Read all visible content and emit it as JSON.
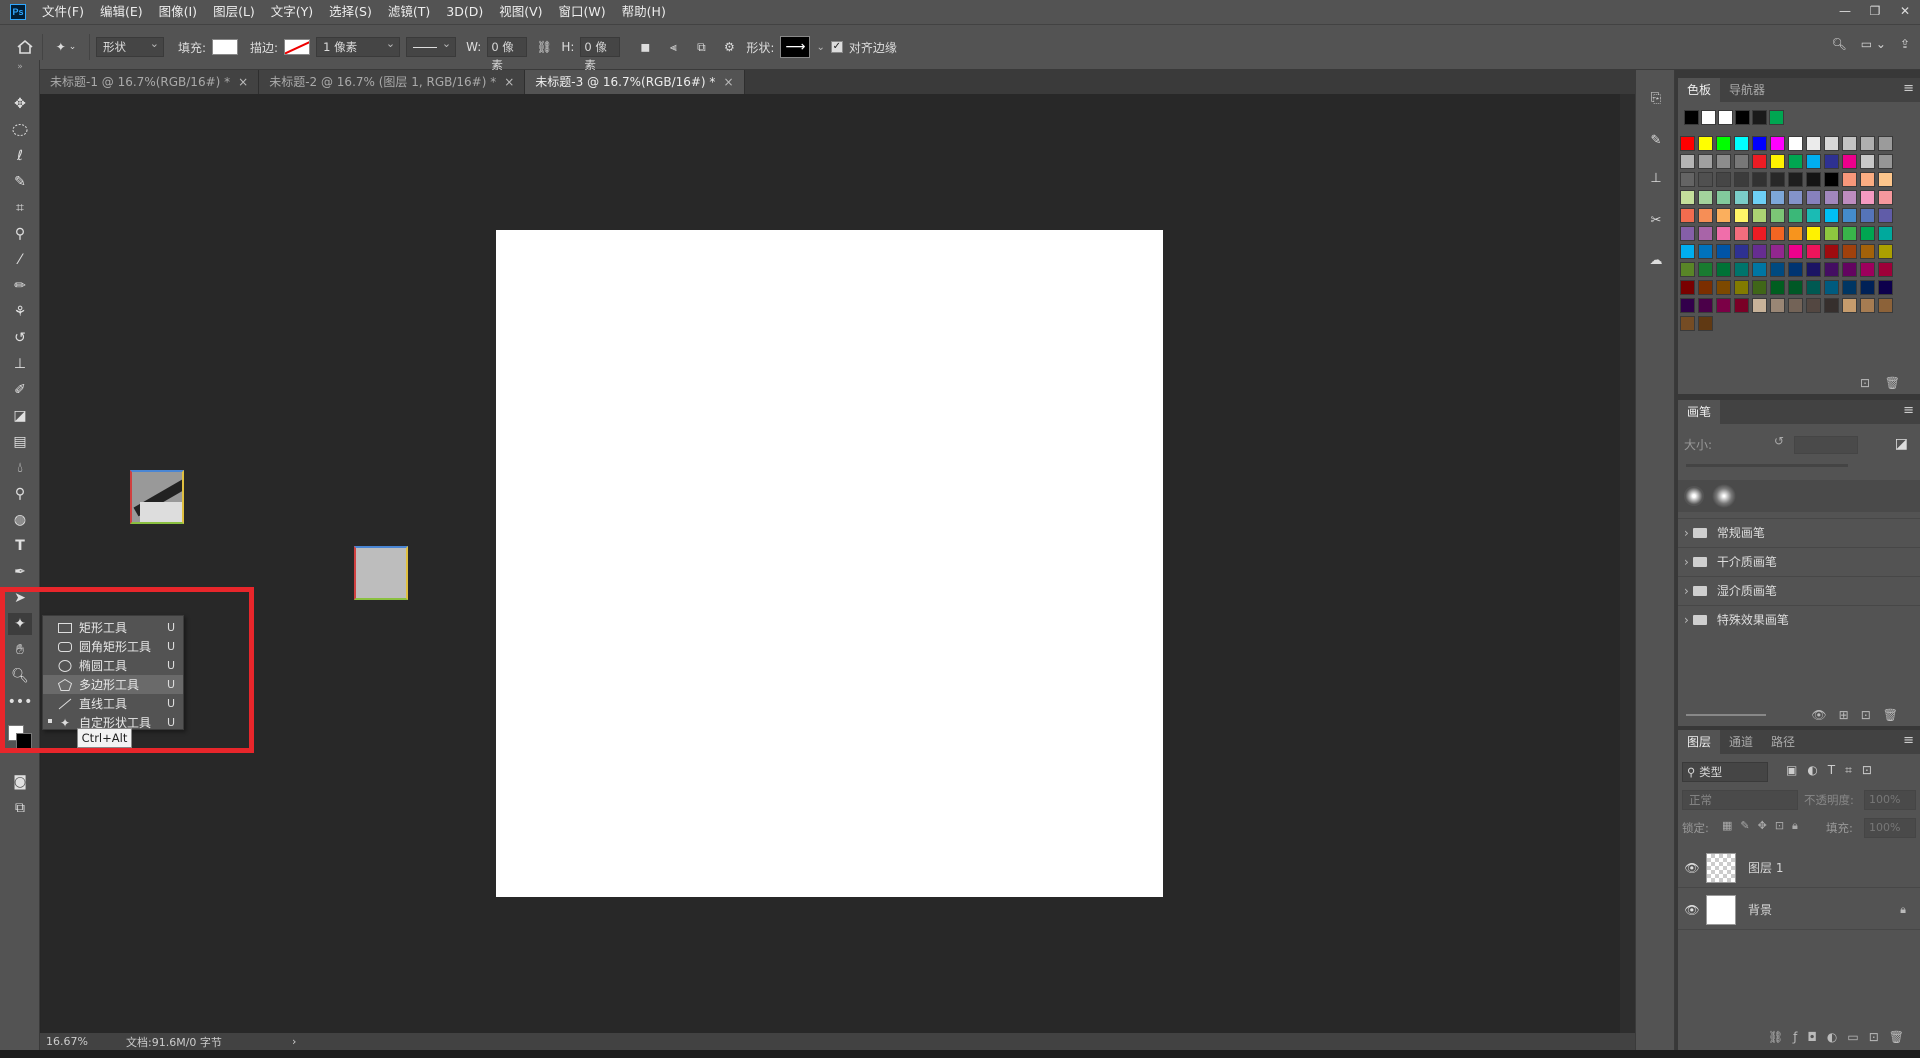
{
  "app": {
    "logo": "Ps"
  },
  "menu": [
    "文件(F)",
    "编辑(E)",
    "图像(I)",
    "图层(L)",
    "文字(Y)",
    "选择(S)",
    "滤镜(T)",
    "3D(D)",
    "视图(V)",
    "窗口(W)",
    "帮助(H)"
  ],
  "options": {
    "mode": "形状",
    "fill_label": "填充:",
    "stroke_label": "描边:",
    "stroke_width": "1 像素",
    "w_label": "W:",
    "w_value": "0 像素",
    "h_label": "H:",
    "h_value": "0 像素",
    "shape_label": "形状:",
    "align_edges": "对齐边缘"
  },
  "tabs": [
    {
      "label": "未标题-1 @ 16.7%(RGB/16#) *",
      "close": "×"
    },
    {
      "label": "未标题-2 @ 16.7% (图层 1, RGB/16#) *",
      "close": "×"
    },
    {
      "label": "未标题-3 @ 16.7%(RGB/16#) *",
      "close": "×"
    }
  ],
  "flyout": {
    "items": [
      {
        "label": "矩形工具",
        "key": "U"
      },
      {
        "label": "圆角矩形工具",
        "key": "U"
      },
      {
        "label": "椭圆工具",
        "key": "U"
      },
      {
        "label": "多边形工具",
        "key": "U"
      },
      {
        "label": "直线工具",
        "key": "U"
      },
      {
        "label": "自定形状工具",
        "key": "U"
      }
    ],
    "tooltip": "Ctrl+Alt"
  },
  "status": {
    "zoom": "16.67%",
    "doc": "文档:91.6M/0 字节",
    "arrow": "›"
  },
  "swatches_panel": {
    "tabs": [
      "色板",
      "导航器"
    ]
  },
  "brush_panel": {
    "tab": "画笔",
    "size_label": "大小:",
    "folders": [
      "常规画笔",
      "干介质画笔",
      "湿介质画笔",
      "特殊效果画笔"
    ]
  },
  "layers_panel": {
    "tabs": [
      "图层",
      "通道",
      "路径"
    ],
    "filter": "类型",
    "blend": "正常",
    "opacity_label": "不透明度:",
    "opacity_value": "100%",
    "lock_label": "锁定:",
    "fill_label": "填充:",
    "fill_value": "100%",
    "layers": [
      {
        "name": "图层 1"
      },
      {
        "name": "背景"
      }
    ]
  },
  "colors": {
    "ui_bg": "#535353",
    "canvas_bg": "#282828",
    "highlight_box": "#e8262b",
    "recent_swatches": [
      "#000000",
      "#ffffff",
      "#ffffff",
      "#000000",
      "#1a1a1a",
      "#00a651"
    ],
    "swatch_rows": [
      [
        "#ff0000",
        "#ffff00",
        "#00ff00",
        "#00ffff",
        "#0000ff",
        "#ff00ff",
        "#ffffff",
        "#ebebeb",
        "#d7d7d7",
        "#c3c3c3",
        "#afafaf",
        "#9b9b9b"
      ],
      [
        "#b4b4b4",
        "#a0a0a0",
        "#8c8c8c",
        "#787878",
        "#ed1c24",
        "#fff200",
        "#00a651",
        "#00aeef",
        "#2e3192",
        "#ec008c",
        "#c8c8c8",
        "#969696"
      ],
      [
        "#646464",
        "#505050",
        "#464646",
        "#3c3c3c",
        "#323232",
        "#282828",
        "#1e1e1e",
        "#141414",
        "#000000",
        "#f7977a",
        "#fbad82",
        "#fdc68c"
      ],
      [
        "#c4df9b",
        "#a3d39c",
        "#82ca9c",
        "#7accc8",
        "#6dcff6",
        "#7da7d9",
        "#8393ca",
        "#8781bd",
        "#a187be",
        "#bd8cbf",
        "#f49ac1",
        "#f6989d"
      ],
      [
        "#f26c4f",
        "#f68e56",
        "#fbaf5d",
        "#fff568",
        "#acd373",
        "#7cc576",
        "#3bb878",
        "#1abbb4",
        "#00bff3",
        "#448ccb",
        "#5574b9",
        "#605ca8"
      ],
      [
        "#855fa8",
        "#a864a8",
        "#f06eaa",
        "#f26d7d",
        "#ed1c24",
        "#f26522",
        "#f7941d",
        "#fff200",
        "#8dc73f",
        "#39b54a",
        "#00a651",
        "#00a99d"
      ],
      [
        "#00aeef",
        "#0072bc",
        "#0054a6",
        "#2e3192",
        "#662d91",
        "#92278f",
        "#ec008c",
        "#ed145b",
        "#9e0b0f",
        "#a0410d",
        "#a36209",
        "#aba000"
      ],
      [
        "#598527",
        "#197b30",
        "#007236",
        "#00746b",
        "#0076a3",
        "#004a80",
        "#003471",
        "#1b1464",
        "#440e62",
        "#630460",
        "#9e005d",
        "#9e0039"
      ],
      [
        "#790000",
        "#7b2e00",
        "#7d4900",
        "#827b00",
        "#406618",
        "#005e20",
        "#005826",
        "#005952",
        "#005b7f",
        "#003663",
        "#002157",
        "#0d004c"
      ],
      [
        "#32004b",
        "#4b0049",
        "#7b0046",
        "#7a0026",
        "#c7b299",
        "#998675",
        "#736357",
        "#534741",
        "#362f2d",
        "#c69c6d",
        "#a67c52",
        "#8c6239"
      ],
      [
        "#754c24",
        "#603913"
      ]
    ]
  }
}
